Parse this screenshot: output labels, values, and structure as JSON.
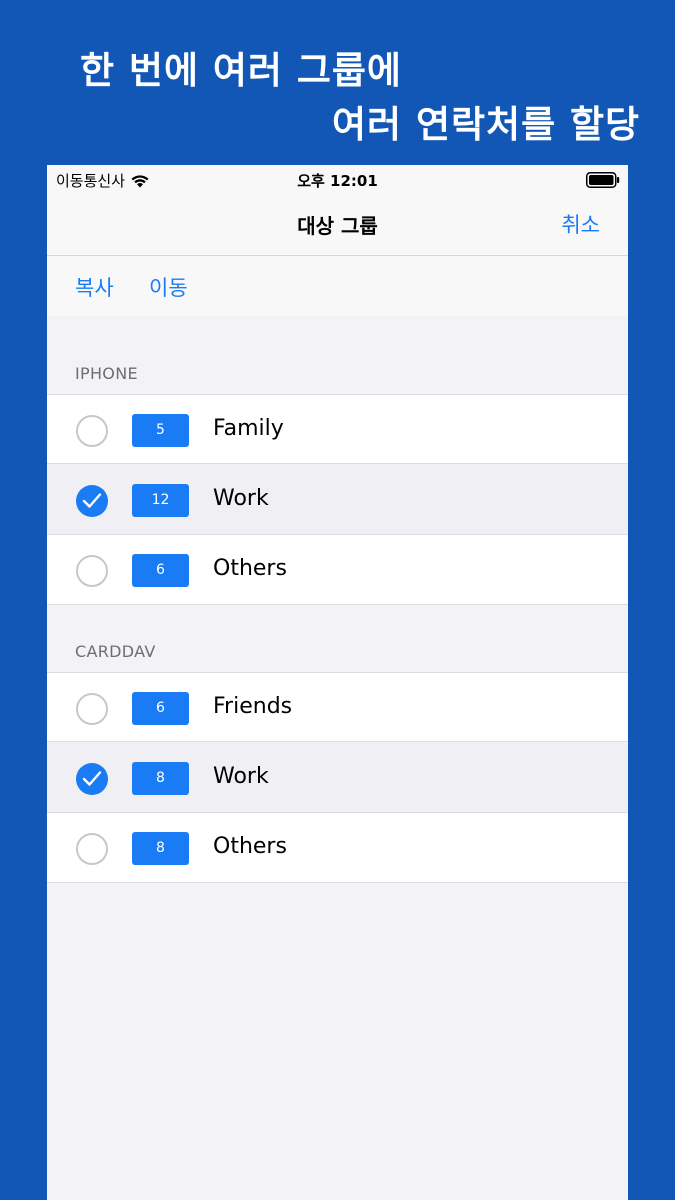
{
  "headline": {
    "line1": "한 번에 여러 그룹에",
    "line2": "여러 연락처를 할당"
  },
  "status_bar": {
    "carrier": "이동통신사",
    "time": "오후 12:01"
  },
  "nav": {
    "title": "대상 그룹",
    "cancel": "취소"
  },
  "toolbar": {
    "copy": "복사",
    "move": "이동"
  },
  "sections": [
    {
      "header": "IPHONE",
      "rows": [
        {
          "count": "5",
          "name": "Family",
          "selected": false
        },
        {
          "count": "12",
          "name": "Work",
          "selected": true
        },
        {
          "count": "6",
          "name": "Others",
          "selected": false
        }
      ]
    },
    {
      "header": "CARDDAV",
      "rows": [
        {
          "count": "6",
          "name": "Friends",
          "selected": false
        },
        {
          "count": "8",
          "name": "Work",
          "selected": true
        },
        {
          "count": "8",
          "name": "Others",
          "selected": false
        }
      ]
    }
  ],
  "colors": {
    "background": "#1257b6",
    "accent": "#1a7cf5"
  }
}
